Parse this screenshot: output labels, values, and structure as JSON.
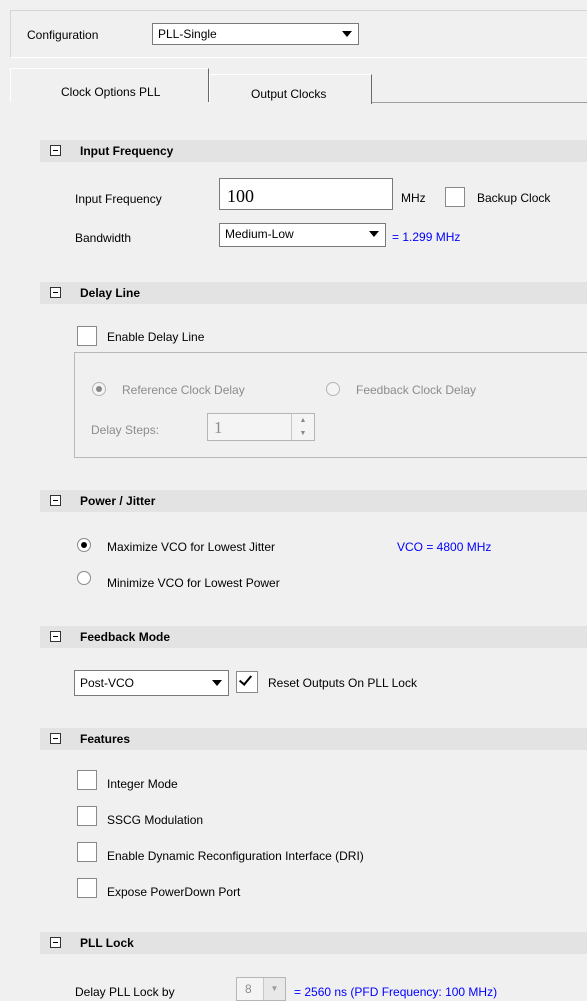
{
  "config": {
    "label": "Configuration",
    "value": "PLL-Single"
  },
  "tabs": [
    {
      "label": "Clock Options PLL",
      "active": true
    },
    {
      "label": "Output Clocks",
      "active": false
    }
  ],
  "input_frequency": {
    "section_title": "Input Frequency",
    "freq_label": "Input Frequency",
    "freq_value": "100",
    "freq_unit": "MHz",
    "backup_label": "Backup Clock",
    "bandwidth_label": "Bandwidth",
    "bandwidth_value": "Medium-Low",
    "bandwidth_result": "= 1.299 MHz"
  },
  "delay_line": {
    "section_title": "Delay Line",
    "enable_label": "Enable Delay Line",
    "ref_clock_label": "Reference Clock Delay",
    "fb_clock_label": "Feedback Clock Delay",
    "steps_label": "Delay Steps:",
    "steps_value": "1"
  },
  "power_jitter": {
    "section_title": "Power / Jitter",
    "max_vco_label": "Maximize VCO for Lowest Jitter",
    "vco_value": "VCO = 4800 MHz",
    "min_vco_label": "Minimize VCO for Lowest Power"
  },
  "feedback_mode": {
    "section_title": "Feedback Mode",
    "mode_value": "Post-VCO",
    "reset_label": "Reset Outputs On PLL Lock"
  },
  "features": {
    "section_title": "Features",
    "items": [
      {
        "label": "Integer Mode",
        "checked": false
      },
      {
        "label": "SSCG Modulation",
        "checked": false
      },
      {
        "label": "Enable Dynamic Reconfiguration Interface (DRI)",
        "checked": false
      },
      {
        "label": "Expose PowerDown Port",
        "checked": false
      }
    ]
  },
  "pll_lock": {
    "section_title": "PLL Lock",
    "delay_label": "Delay PLL Lock by",
    "delay_value": "8",
    "delay_result": "= 2560 ns (PFD Frequency: 100 MHz)"
  }
}
